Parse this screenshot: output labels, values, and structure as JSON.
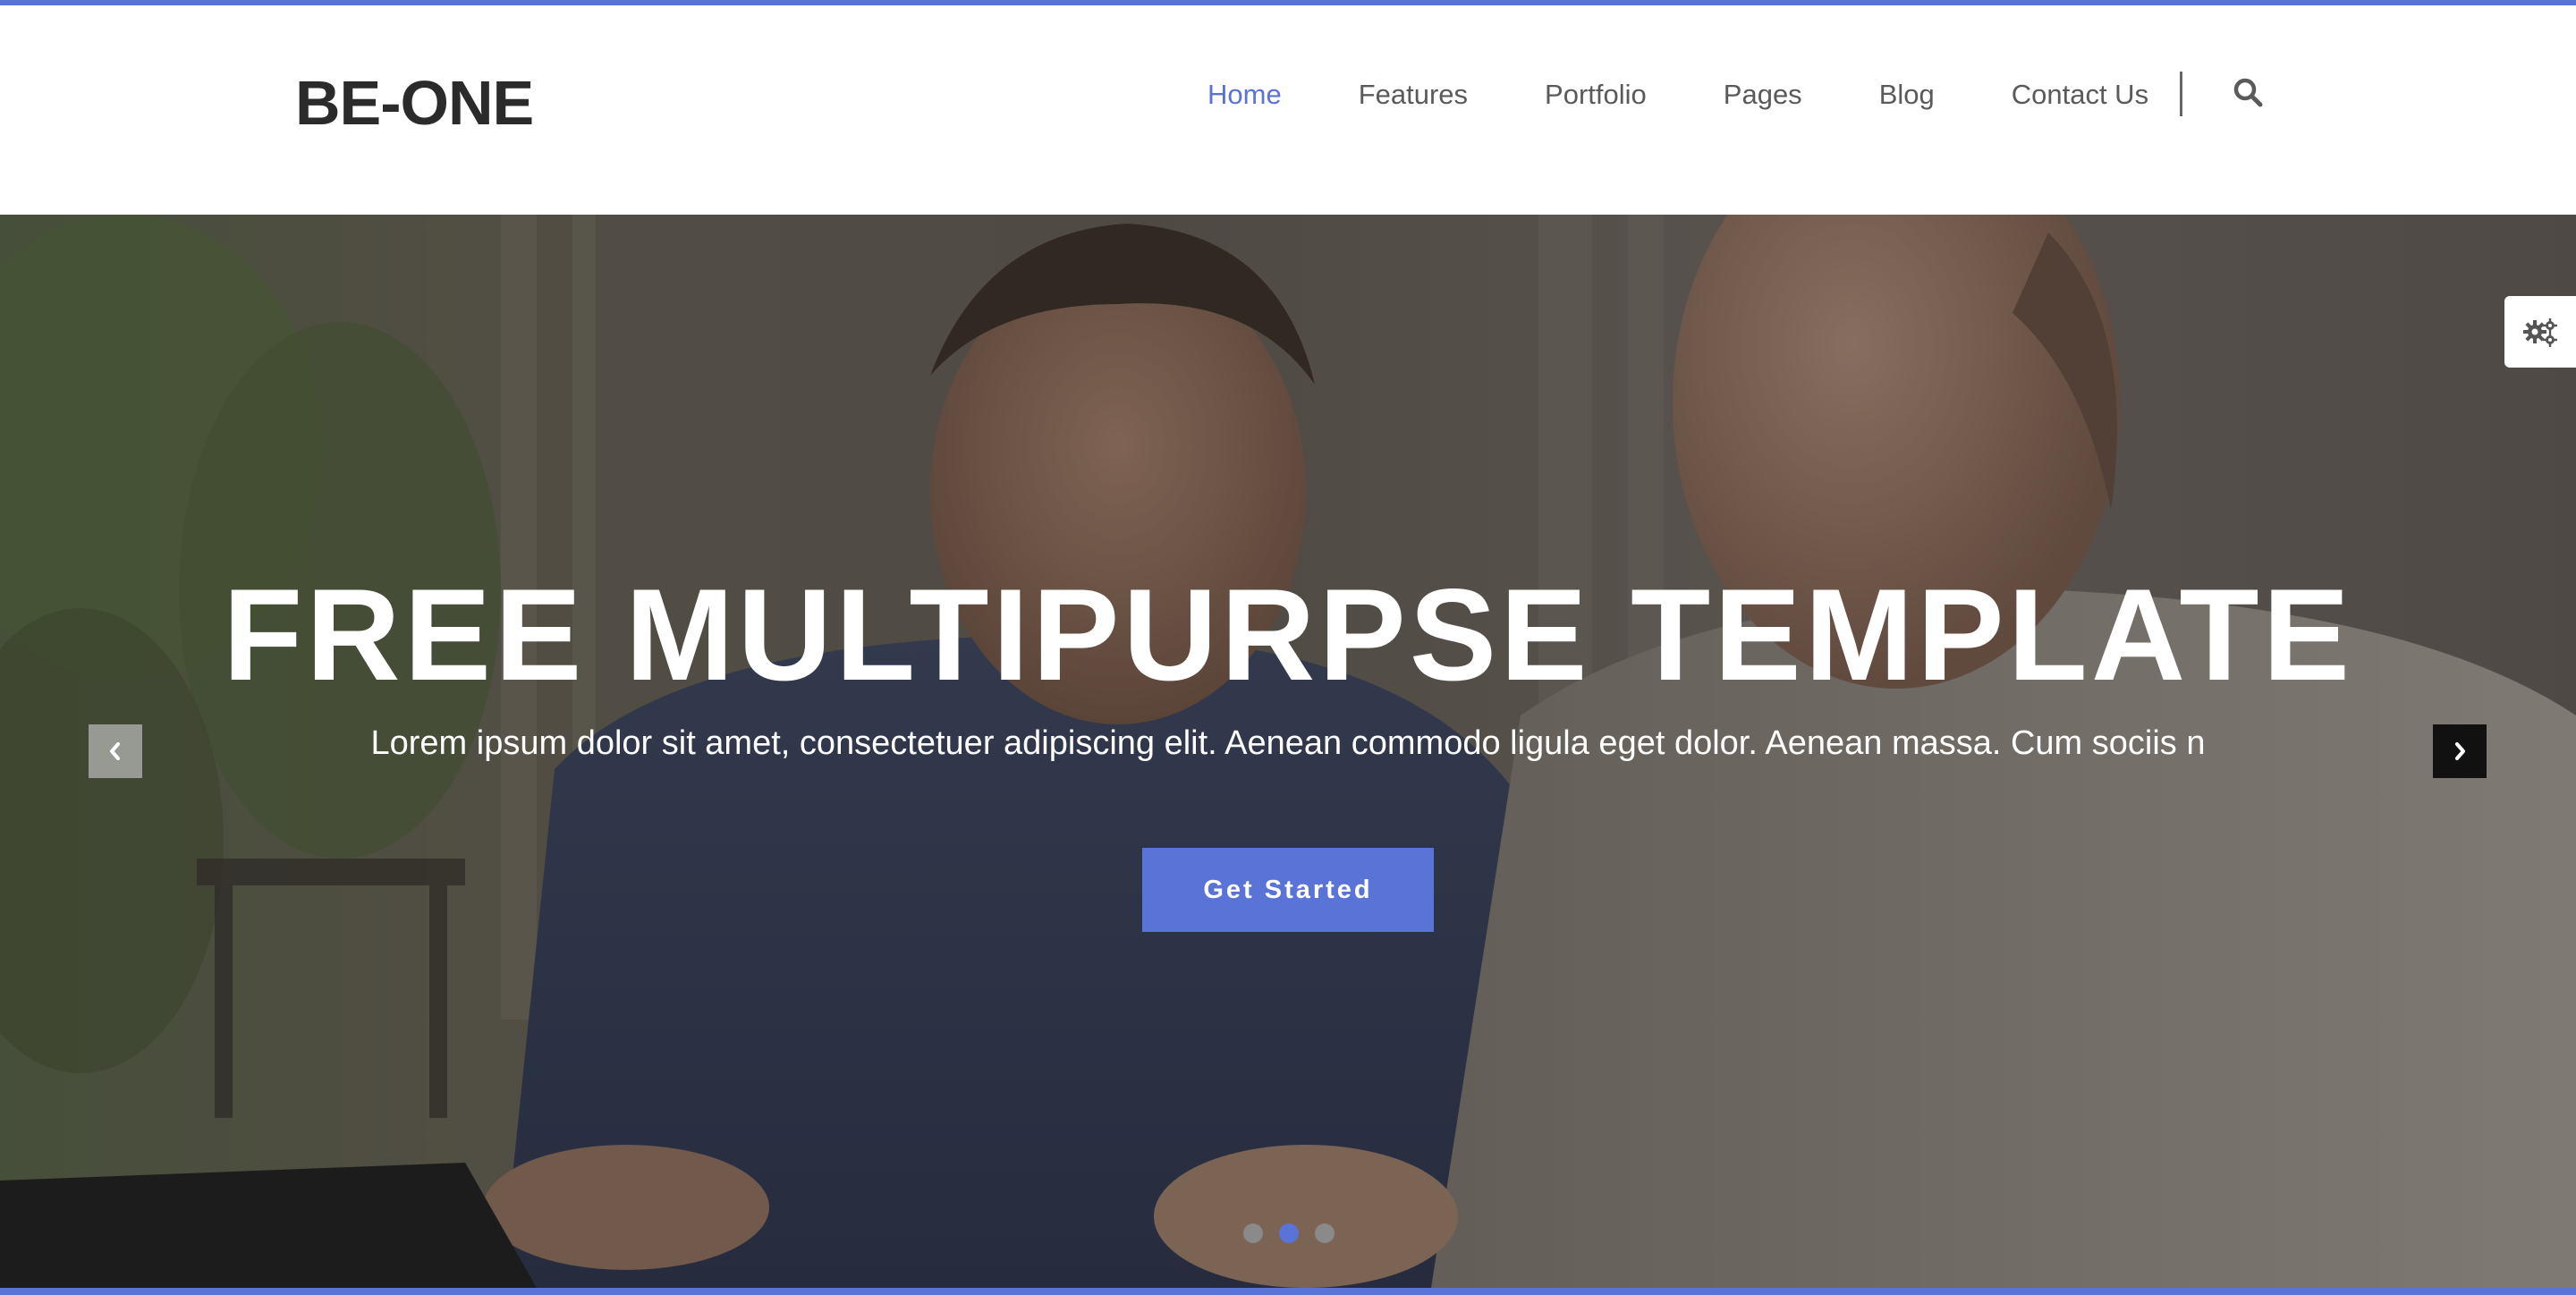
{
  "brand": {
    "logo_text": "BE-ONE",
    "accent_color": "#5a73d6"
  },
  "nav": {
    "items": [
      {
        "label": "Home",
        "active": true
      },
      {
        "label": "Features",
        "active": false
      },
      {
        "label": "Portfolio",
        "active": false
      },
      {
        "label": "Pages",
        "active": false
      },
      {
        "label": "Blog",
        "active": false
      },
      {
        "label": "Contact Us",
        "active": false
      }
    ],
    "search_icon": "search-icon"
  },
  "hero": {
    "title": "FREE MULTIPURPSE TEMPLATE",
    "subtitle": "Lorem ipsum dolor sit amet, consectetuer adipiscing elit. Aenean commodo ligula eget dolor. Aenean massa. Cum sociis n",
    "cta_label": "Get Started",
    "prev_icon": "chevron-left-icon",
    "next_icon": "chevron-right-icon",
    "slides": 3,
    "active_slide": 2
  },
  "settings": {
    "icon": "gears-icon"
  }
}
